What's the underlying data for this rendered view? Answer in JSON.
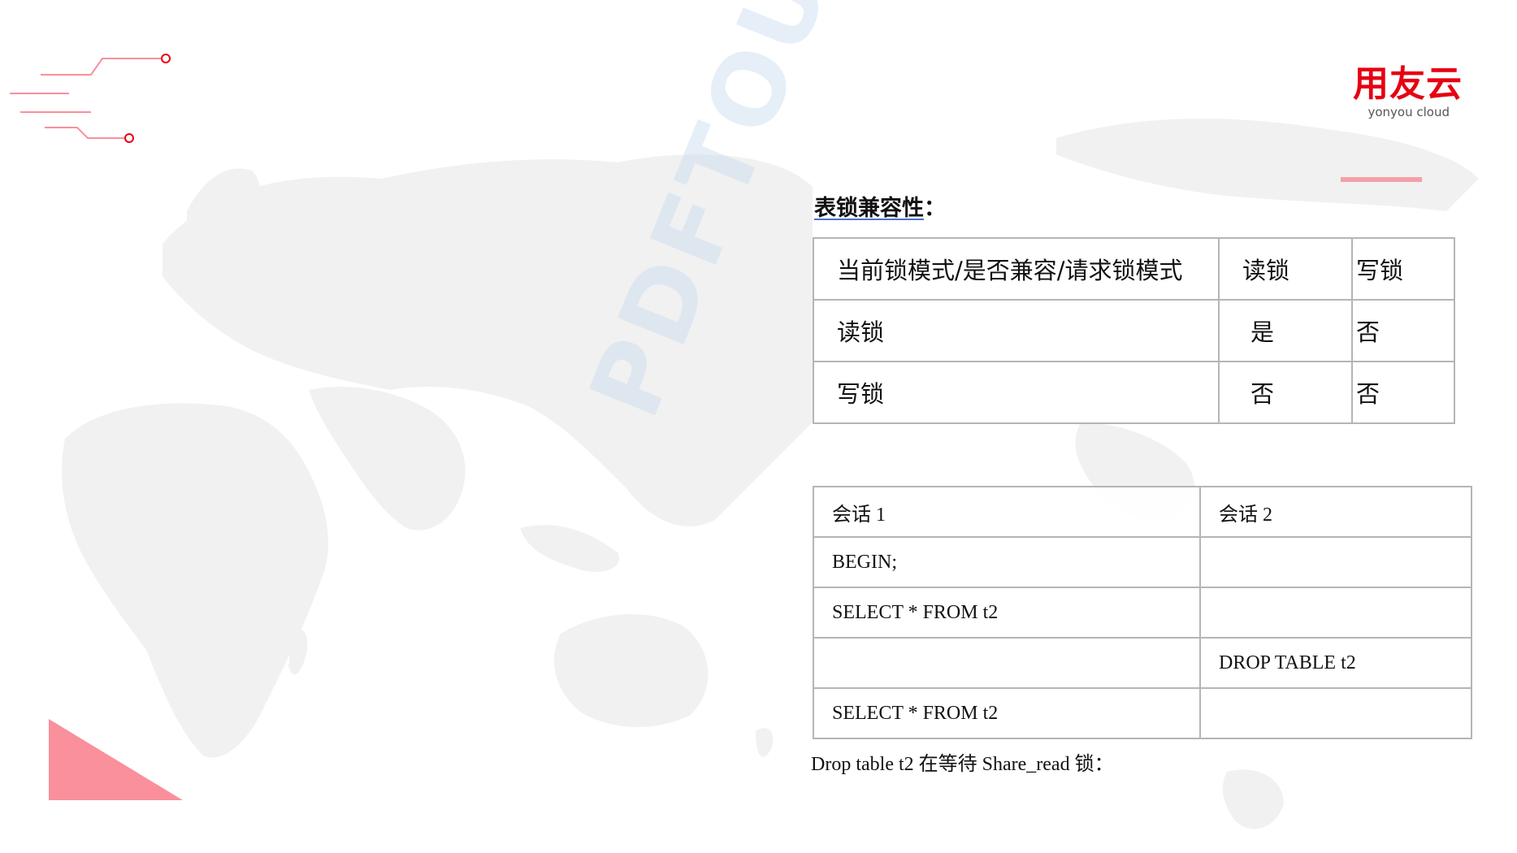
{
  "logo": {
    "name": "用友云",
    "sub": "yonyou cloud"
  },
  "watermark": "PDFTOU",
  "heading": {
    "underlined": "表锁兼容性",
    "suffix": "："
  },
  "compat_table": {
    "rows": [
      [
        "当前锁模式/是否兼容/请求锁模式",
        "读锁",
        "写锁"
      ],
      [
        "读锁",
        "是",
        "否"
      ],
      [
        "写锁",
        "否",
        "否"
      ]
    ]
  },
  "session_table": {
    "rows": [
      [
        "会话 1",
        "会话 2"
      ],
      [
        "BEGIN;",
        ""
      ],
      [
        "SELECT * FROM t2",
        ""
      ],
      [
        "",
        "DROP TABLE t2"
      ],
      [
        "SELECT * FROM t2",
        ""
      ]
    ]
  },
  "caption": "Drop table t2 在等待 Share_read 锁：",
  "colors": {
    "brand_red": "#e60012",
    "accent_pink": "#f9909b",
    "map_gray": "#f2f2f2",
    "border": "#b5b5b5"
  }
}
